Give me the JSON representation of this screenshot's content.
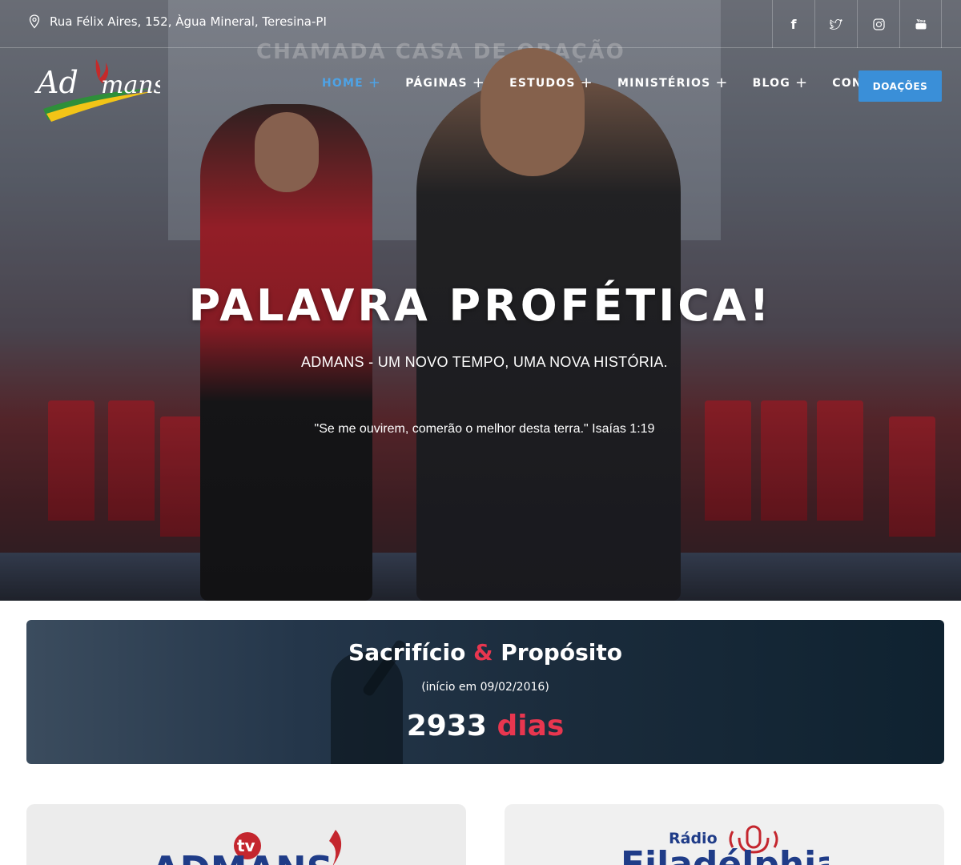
{
  "topbar": {
    "address": "Rua Félix Aires, 152, Àgua Mineral, Teresina-PI",
    "address_icon": "map-pin-icon",
    "socials": [
      {
        "name": "facebook",
        "icon": "facebook-icon",
        "glyph": "f"
      },
      {
        "name": "twitter",
        "icon": "twitter-icon",
        "glyph": "t"
      },
      {
        "name": "instagram",
        "icon": "instagram-icon",
        "glyph": "◎"
      },
      {
        "name": "youtube",
        "icon": "youtube-icon",
        "glyph": "▶"
      }
    ]
  },
  "logo": {
    "text": "Admans"
  },
  "nav": {
    "items": [
      {
        "label": "HOME",
        "has_submenu": true,
        "active": true
      },
      {
        "label": "PÁGINAS",
        "has_submenu": true,
        "active": false
      },
      {
        "label": "ESTUDOS",
        "has_submenu": true,
        "active": false
      },
      {
        "label": "MINISTÉRIOS",
        "has_submenu": true,
        "active": false
      },
      {
        "label": "BLOG",
        "has_submenu": true,
        "active": false
      },
      {
        "label": "CONTATOS",
        "has_submenu": false,
        "active": false
      }
    ],
    "donate_label": "DOAÇÕES"
  },
  "hero": {
    "background_text": "CHAMADA CASA DE ORAÇÃO",
    "title": "PALAVRA PROFÉTICA!",
    "subtitle": "ADMANS - UM NOVO TEMPO, UMA NOVA HISTÓRIA.",
    "verse": "\"Se me ouvirem, comerão o melhor desta terra.\" Isaías 1:19"
  },
  "banner": {
    "title_part1": "Sacrifício",
    "title_amp": "&",
    "title_part2": "Propósito",
    "subtitle": "(início em 09/02/2016)",
    "count_value": "2933",
    "count_unit": "dias"
  },
  "cards": {
    "left_logo_text": "ADMANS",
    "left_logo_badge": "tv",
    "right_logo_top": "Rádio",
    "right_logo_main": "Filadélphia"
  },
  "colors": {
    "accent_blue": "#3a8fd8",
    "nav_active": "#4ea3e6",
    "accent_red": "#e8364f"
  }
}
